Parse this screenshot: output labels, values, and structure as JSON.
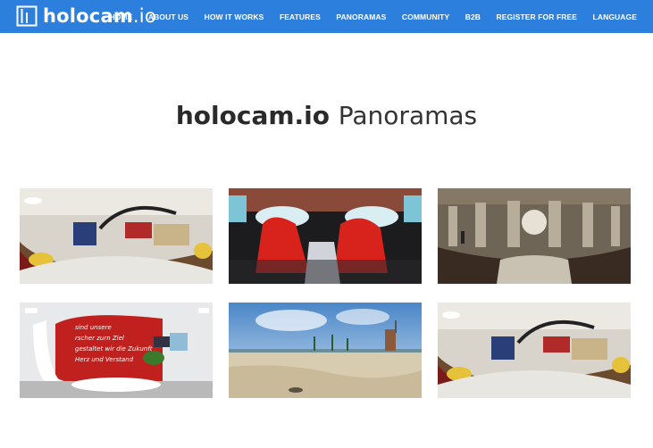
{
  "brand": {
    "name_bold": "holocam",
    "name_rest": ".io"
  },
  "nav": {
    "items": [
      {
        "label": "HOME",
        "active": false
      },
      {
        "label": "ABOUT US",
        "active": false
      },
      {
        "label": "HOW IT WORKS",
        "active": false
      },
      {
        "label": "FEATURES",
        "active": true
      },
      {
        "label": "PANORAMAS",
        "active": false
      },
      {
        "label": "COMMUNITY",
        "active": false
      },
      {
        "label": "B2B",
        "active": false
      },
      {
        "label": "REGISTER FOR FREE",
        "active": false
      },
      {
        "label": "LANGUAGE",
        "active": false
      }
    ]
  },
  "page": {
    "title_bold": "holocam.io",
    "title_light": "Panoramas"
  },
  "panoramas": [
    {
      "scene": "office-lounge"
    },
    {
      "scene": "car-interior"
    },
    {
      "scene": "church-interior"
    },
    {
      "scene": "office-wall-lettering",
      "visible_text": [
        "sind unsere",
        "rscher zurn Ziel",
        "gestaltet wir die Zukunft",
        "Herz und Verstand"
      ]
    },
    {
      "scene": "beach"
    },
    {
      "scene": "office-lounge"
    }
  ],
  "colors": {
    "navbar": "#2d7fdd",
    "title": "#2a2a2a",
    "background": "#ffffff"
  }
}
